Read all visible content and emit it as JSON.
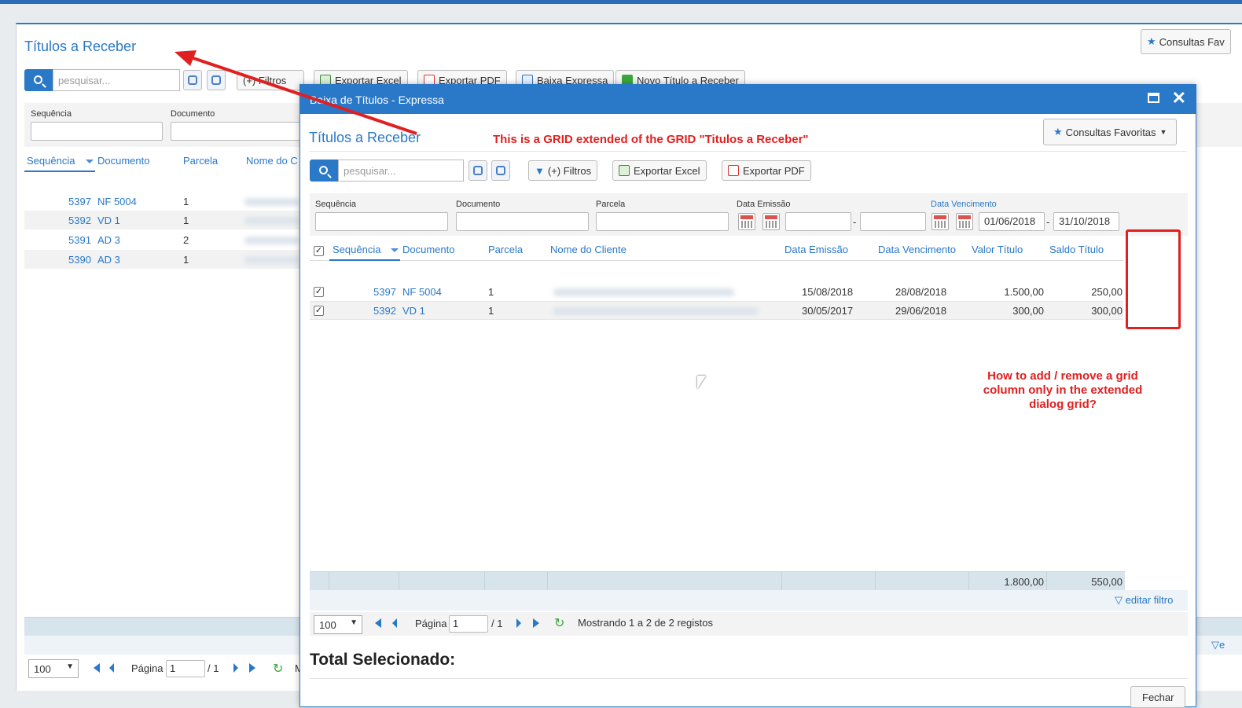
{
  "bg": {
    "title": "Títulos a Receber",
    "fav_label": "Consultas Fav",
    "search_placeholder": "pesquisar...",
    "buttons": {
      "filters": "(+) Filtros",
      "excel": "Exportar Excel",
      "pdf": "Exportar PDF",
      "baixa": "Baixa Expressa",
      "novo": "Novo Título a Receber"
    },
    "filter_labels": {
      "seq": "Sequência",
      "doc": "Documento"
    },
    "columns": {
      "seq": "Sequência",
      "doc": "Documento",
      "parcela": "Parcela",
      "cliente": "Nome do C"
    },
    "rows": [
      {
        "seq": "5397",
        "doc": "NF 5004",
        "parcela": "1"
      },
      {
        "seq": "5392",
        "doc": "VD 1",
        "parcela": "1"
      },
      {
        "seq": "5391",
        "doc": "AD 3",
        "parcela": "2"
      },
      {
        "seq": "5390",
        "doc": "AD 3",
        "parcela": "1"
      }
    ],
    "footer": {
      "pagesize": "100",
      "page_label": "Página",
      "page": "1",
      "of": "/ 1",
      "more": "M",
      "edit_partial": "e"
    }
  },
  "dialog": {
    "title": "Baixa de Títulos - Expressa",
    "heading": "Títulos a Receber",
    "fav_label": "Consultas Favoritas",
    "search_placeholder": "pesquisar...",
    "buttons": {
      "filters": "(+) Filtros",
      "excel": "Exportar Excel",
      "pdf": "Exportar PDF"
    },
    "filter_labels": {
      "seq": "Sequência",
      "doc": "Documento",
      "parcela": "Parcela",
      "emissao": "Data Emissão",
      "vencimento": "Data Vencimento"
    },
    "venc_from": "01/06/2018",
    "venc_to": "31/10/2018",
    "dash": "-",
    "columns": {
      "seq": "Sequência",
      "doc": "Documento",
      "parcela": "Parcela",
      "cliente": "Nome do Cliente",
      "emissao": "Data Emissão",
      "vencimento": "Data Vencimento",
      "valor": "Valor Título",
      "saldo": "Saldo Título"
    },
    "rows": [
      {
        "seq": "5397",
        "doc": "NF 5004",
        "parcela": "1",
        "emissao": "15/08/2018",
        "vencimento": "28/08/2018",
        "valor": "1.500,00",
        "saldo": "250,00"
      },
      {
        "seq": "5392",
        "doc": "VD 1",
        "parcela": "1",
        "emissao": "30/05/2017",
        "vencimento": "29/06/2018",
        "valor": "300,00",
        "saldo": "300,00"
      }
    ],
    "totals": {
      "valor": "1.800,00",
      "saldo": "550,00"
    },
    "edit_filter": "editar filtro",
    "footer": {
      "pagesize": "100",
      "page_label": "Página",
      "page": "1",
      "of": "/ 1",
      "status": "Mostrando 1 a 2 de 2 registos"
    },
    "total_selected": "Total Selecionado:",
    "close": "Fechar"
  },
  "annotations": {
    "top": "This is a GRID extended of the  GRID \"Titulos a Receber\"",
    "question": "How to add / remove a grid column only in the extended dialog grid?"
  },
  "colors": {
    "accent": "#2a78c8",
    "annotation": "#e02020"
  }
}
